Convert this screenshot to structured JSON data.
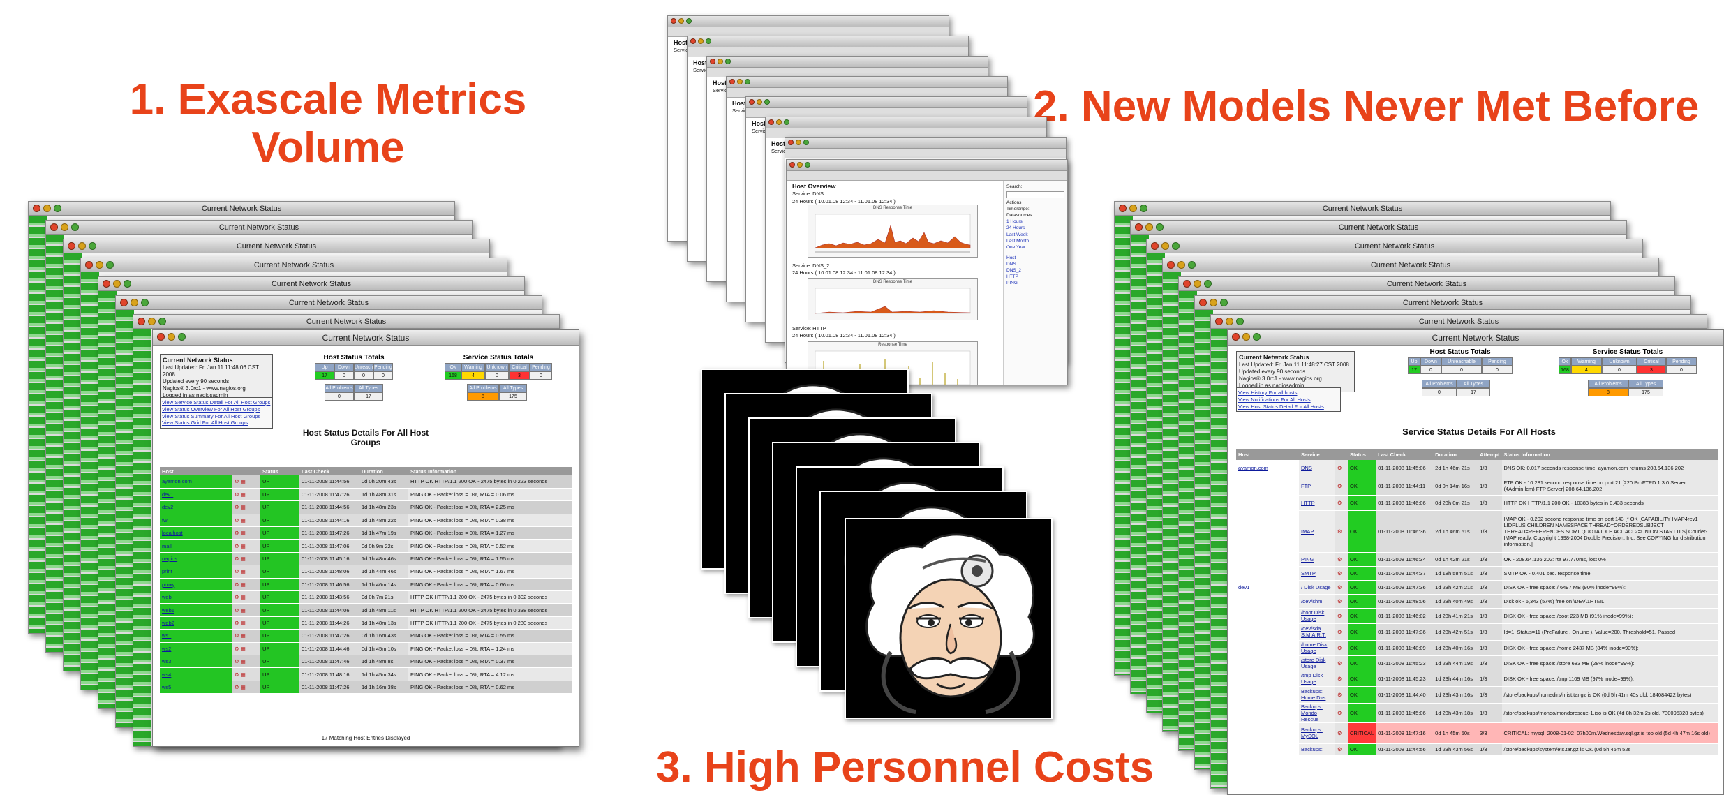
{
  "headings": {
    "h1_line1": "1. Exascale Metrics",
    "h1_line2": "Volume",
    "h2": "2. New Models Never Met Before",
    "h3": "3. High Personnel Costs"
  },
  "colors": {
    "heading": "#e8431a",
    "status_ok": "#22cc22",
    "status_critical": "#ff3a3a",
    "warning": "#ffd800",
    "unknown": "#ff9a00"
  },
  "left_window": {
    "title": "Current Network Status",
    "info": {
      "title": "Current Network Status",
      "lines": [
        "Last Updated: Fri Jan 11 11:48:06 CST 2008",
        "Updated every 90 seconds",
        "Nagios® 3.0rc1 - www.nagios.org",
        "Logged in as nagiosadmin"
      ]
    },
    "links": [
      "View Service Status Detail For All Host Groups",
      "View Status Overview For All Host Groups",
      "View Status Summary For All Host Groups",
      "View Status Grid For All Host Groups"
    ],
    "host_totals": {
      "title": "Host Status Totals",
      "headers": [
        "Up",
        "Down",
        "Unreachable",
        "Pending"
      ],
      "values": [
        "17",
        "0",
        "0",
        "0"
      ],
      "sub_headers": [
        "All Problems",
        "All Types"
      ],
      "sub_values": [
        "0",
        "17"
      ]
    },
    "service_totals": {
      "title": "Service Status Totals",
      "headers": [
        "Ok",
        "Warning",
        "Unknown",
        "Critical",
        "Pending"
      ],
      "values": [
        "168",
        "4",
        "0",
        "3",
        "0"
      ],
      "sub_headers": [
        "All Problems",
        "All Types"
      ],
      "sub_values": [
        "8",
        "175"
      ]
    },
    "section_title_1": "Host Status Details For All Host",
    "section_title_2": "Groups",
    "columns": [
      "Host",
      "Status",
      "Last Check",
      "Duration",
      "Status Information"
    ],
    "rows": [
      [
        "ayamon.com",
        "UP",
        "01-11-2008 11:44:56",
        "0d 0h 20m 43s",
        "HTTP OK HTTP/1.1 200 OK - 2475 bytes in 0.223 seconds"
      ],
      [
        "dev1",
        "UP",
        "01-11-2008 11:47:26",
        "1d 1h 48m 31s",
        "PING OK - Packet loss = 0%, RTA = 0.06 ms"
      ],
      [
        "dev2",
        "UP",
        "01-11-2008 11:44:56",
        "1d 1h 48m 23s",
        "PING OK - Packet loss = 0%, RTA = 2.25 ms"
      ],
      [
        "fw",
        "UP",
        "01-11-2008 11:44:16",
        "1d 1h 48m 22s",
        "PING OK - Packet loss = 0%, RTA = 0.38 ms"
      ],
      [
        "localhost",
        "UP",
        "01-11-2008 11:47:26",
        "1d 1h 47m 19s",
        "PING OK - Packet loss = 0%, RTA = 1.27 ms"
      ],
      [
        "mail",
        "UP",
        "01-11-2008 11:47:06",
        "0d 0h 9m 22s",
        "PING OK - Packet loss = 0%, RTA = 0.52 ms"
      ],
      [
        "nagios",
        "UP",
        "01-11-2008 11:45:16",
        "1d 1h 48m 46s",
        "PING OK - Packet loss = 0%, RTA = 1.55 ms"
      ],
      [
        "print",
        "UP",
        "01-11-2008 11:48:06",
        "1d 1h 44m 46s",
        "PING OK - Packet loss = 0%, RTA = 1.67 ms"
      ],
      [
        "proxy",
        "UP",
        "01-11-2008 11:46:56",
        "1d 1h 46m 14s",
        "PING OK - Packet loss = 0%, RTA = 0.66 ms"
      ],
      [
        "web",
        "UP",
        "01-11-2008 11:43:56",
        "0d 0h 7m 21s",
        "HTTP OK HTTP/1.1 200 OK - 2475 bytes in 0.302 seconds"
      ],
      [
        "web1",
        "UP",
        "01-11-2008 11:44:06",
        "1d 1h 48m 11s",
        "HTTP OK HTTP/1.1 200 OK - 2475 bytes in 0.338 seconds"
      ],
      [
        "web2",
        "UP",
        "01-11-2008 11:44:26",
        "1d 1h 48m 13s",
        "HTTP OK HTTP/1.1 200 OK - 2475 bytes in 0.230 seconds"
      ],
      [
        "ws1",
        "UP",
        "01-11-2008 11:47:26",
        "0d 1h 16m 43s",
        "PING OK - Packet loss = 0%, RTA = 0.55 ms"
      ],
      [
        "ws2",
        "UP",
        "01-11-2008 11:44:46",
        "0d 1h 45m 10s",
        "PING OK - Packet loss = 0%, RTA = 1.24 ms"
      ],
      [
        "ws3",
        "UP",
        "01-11-2008 11:47:46",
        "1d 1h 48m 8s",
        "PING OK - Packet loss = 0%, RTA = 0.37 ms"
      ],
      [
        "ws4",
        "UP",
        "01-11-2008 11:48:16",
        "1d 1h 45m 34s",
        "PING OK - Packet loss = 0%, RTA = 4.12 ms"
      ],
      [
        "ws5",
        "UP",
        "01-11-2008 11:47:26",
        "1d 1h 16m 38s",
        "PING OK - Packet loss = 0%, RTA = 0.62 ms"
      ]
    ],
    "footer": "17 Matching Host Entries Displayed"
  },
  "right_window": {
    "title": "Current Network Status",
    "info": {
      "title": "Current Network Status",
      "lines": [
        "Last Updated: Fri Jan 11 11:48:27 CST 2008",
        "Updated every 90 seconds",
        "Nagios® 3.0rc1 - www.nagios.org",
        "Logged in as nagiosadmin"
      ]
    },
    "links": [
      "View History For all hosts",
      "View Notifications For All Hosts",
      "View Host Status Detail For All Hosts"
    ],
    "host_totals": {
      "title": "Host Status Totals",
      "headers": [
        "Up",
        "Down",
        "Unreachable",
        "Pending"
      ],
      "values": [
        "17",
        "0",
        "0",
        "0"
      ],
      "sub_headers": [
        "All Problems",
        "All Types"
      ],
      "sub_values": [
        "0",
        "17"
      ]
    },
    "service_totals": {
      "title": "Service Status Totals",
      "headers": [
        "Ok",
        "Warning",
        "Unknown",
        "Critical",
        "Pending"
      ],
      "values": [
        "168",
        "4",
        "0",
        "3",
        "0"
      ],
      "sub_headers": [
        "All Problems",
        "All Types"
      ],
      "sub_values": [
        "8",
        "175"
      ]
    },
    "section_title": "Service Status Details For All Hosts",
    "columns": [
      "Host",
      "Service",
      "Status",
      "Last Check",
      "Duration",
      "Attempt",
      "Status Information"
    ],
    "rows": [
      {
        "host": "ayamon.com",
        "service": "DNS",
        "status": "OK",
        "last": "01-11-2008 11:45:06",
        "dur": "2d 1h 46m 21s",
        "att": "1/3",
        "info": "DNS OK: 0.017 seconds response time. ayamon.com returns 208.64.136.202",
        "h": 24
      },
      {
        "host": "",
        "service": "FTP",
        "status": "OK",
        "last": "01-11-2008 11:44:11",
        "dur": "0d 0h 14m 16s",
        "att": "1/3",
        "info": "FTP OK - 10.281 second response time on port 21 [220 ProFTPD 1.3.0 Server (4Admin.lcm) FTP Server] 208.64.136.202",
        "h": 26
      },
      {
        "host": "",
        "service": "HTTP",
        "status": "OK",
        "last": "01-11-2008 11:46:06",
        "dur": "0d 23h 0m 21s",
        "att": "1/3",
        "info": "HTTP OK HTTP/1.1 200 OK - 10383 bytes in 0.433 seconds",
        "h": 22
      },
      {
        "host": "",
        "service": "IMAP",
        "status": "OK",
        "last": "01-11-2008 11:46:36",
        "dur": "2d 1h 46m 51s",
        "att": "1/3",
        "info": "IMAP OK - 0.202 second response time on port 143 [* OK [CAPABILITY IMAP4rev1 LIDPLUS CHILDREN NAMESPACE THREAD=ORDEREDSUBJECT THREAD=REFERENCES SORT QUOTA IDLE ACL ACL2=UNION STARTTLS] Courier-IMAP ready. Copyright 1998-2004 Double Precision, Inc. See COPYING for distribution information.]",
        "h": 60
      },
      {
        "host": "",
        "service": "PING",
        "status": "OK",
        "last": "01-11-2008 11:46:34",
        "dur": "0d 1h 42m 21s",
        "att": "1/3",
        "info": "OK - 208.64.136.202: rta 97.770ms, lost 0%",
        "h": 20
      },
      {
        "host": "",
        "service": "SMTP",
        "status": "OK",
        "last": "01-11-2008 11:44:37",
        "dur": "1d 18h 58m 51s",
        "att": "1/3",
        "info": "SMTP OK - 0.401 sec. response time",
        "h": 20
      },
      {
        "host": "dev1",
        "service": "/ Disk Usage",
        "status": "OK",
        "last": "01-11-2008 11:47:36",
        "dur": "1d 23h 42m 21s",
        "att": "1/3",
        "info": "DISK OK - free space: / 6497 MB (90% inode=99%):",
        "h": 20
      },
      {
        "host": "",
        "service": "/dev/shm",
        "status": "OK",
        "last": "01-11-2008 11:48:06",
        "dur": "1d 23h 40m 49s",
        "att": "1/3",
        "info": "Disk ok - 6,343 (57%) free on \\DEV\\1HTML",
        "h": 20
      },
      {
        "host": "",
        "service": "/boot Disk Usage",
        "status": "OK",
        "last": "01-11-2008 11:46:02",
        "dur": "1d 23h 41m 21s",
        "att": "1/3",
        "info": "DISK OK - free space: /boot 223 MB (91% inode=99%):",
        "h": 22
      },
      {
        "host": "",
        "service": "/dev/sda S.M.A.R.T.",
        "status": "OK",
        "last": "01-11-2008 11:47:36",
        "dur": "1d 23h 42m 51s",
        "att": "1/3",
        "info": "Id=1, Status=11 (PreFailure , OnLine ), Value=200, Threshold=51, Passed",
        "h": 24
      },
      {
        "host": "",
        "service": "/home Disk Usage",
        "status": "OK",
        "last": "01-11-2008 11:48:09",
        "dur": "1d 23h 40m 16s",
        "att": "1/3",
        "info": "DISK OK - free space: /home 2437 MB (84% inode=93%):",
        "h": 22
      },
      {
        "host": "",
        "service": "/store Disk Usage",
        "status": "OK",
        "last": "01-11-2008 11:45:23",
        "dur": "1d 23h 44m 19s",
        "att": "1/3",
        "info": "DISK OK - free space: /store 683 MB (28% inode=99%):",
        "h": 22
      },
      {
        "host": "",
        "service": "/tmp Disk Usage",
        "status": "OK",
        "last": "01-11-2008 11:45:23",
        "dur": "1d 23h 44m 16s",
        "att": "1/3",
        "info": "DISK OK - free space: /tmp 1109 MB (97% inode=99%):",
        "h": 22
      },
      {
        "host": "",
        "service": "Backups: Home Dirs",
        "status": "OK",
        "last": "01-11-2008 11:44:40",
        "dur": "1d 23h 43m 16s",
        "att": "1/3",
        "info": "/store/backups/homedirs/mist.tar.gz is OK (0d 5h 41m 40s old, 184084422 bytes)",
        "h": 24
      },
      {
        "host": "",
        "service": "Backups: Mondo Rescue",
        "status": "OK",
        "last": "01-11-2008 11:45:06",
        "dur": "1d 23h 43m 18s",
        "att": "1/3",
        "info": "/store/backups/mondo/mondorescue-1.iso is OK (4d 8h 32m 2s old, 730095328 bytes)",
        "h": 24
      },
      {
        "host": "",
        "service": "Backups: MySQL",
        "status": "CRITICAL",
        "last": "01-11-2008 11:47:16",
        "dur": "0d 1h 45m 50s",
        "att": "3/3",
        "info": "CRITICAL: mysql_2008-01-02_07h00m.Wednesday.sql.gz is too old (5d 4h 47m 16s old)",
        "h": 30
      },
      {
        "host": "",
        "service": "Backups:",
        "status": "OK",
        "last": "01-11-2008 11:44:56",
        "dur": "1d 23h 43m 56s",
        "att": "1/3",
        "info": "/store/backups/system/etc.tar.gz is OK (0d 5h 45m 52s",
        "h": 16
      }
    ]
  },
  "graph_window": {
    "title": "Host Overview",
    "service_1": "Service: DNS",
    "range": "24 Hours ( 10.01.08 12:34 - 11.01.08 12:34 )",
    "service_2": "Service: DNS_2",
    "service_3": "Service: HTTP",
    "graph_title_1": "DNS Response Time",
    "graph_title_2": "DNS Response Time",
    "graph_title_3": "Response Time",
    "sidebar": [
      "Search:",
      "",
      "Actions",
      "Timerange:",
      "Datasources",
      "1 Hours",
      "24 Hours",
      "Last Week",
      "Last Month",
      "One Year",
      "Host",
      "DNS",
      "DNS_2",
      "HTTP",
      "PING"
    ]
  }
}
